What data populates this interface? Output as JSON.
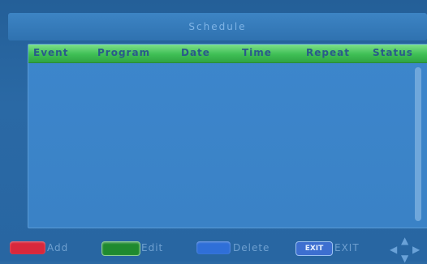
{
  "window": {
    "title": "Schedule"
  },
  "table": {
    "columns": [
      "Event",
      "Program",
      "Date",
      "Time",
      "Repeat",
      "Status"
    ],
    "rows": []
  },
  "footer": {
    "add_label": "Add",
    "edit_label": "Edit",
    "delete_label": "Delete",
    "exit_key_label": "EXIT",
    "exit_label": "EXIT"
  },
  "colors": {
    "add": "#d8283c",
    "edit": "#1f8a2f",
    "delete": "#2f6fd8",
    "header": "#3fbf55"
  },
  "icons": {
    "navigation": "direction-pad-icon"
  }
}
